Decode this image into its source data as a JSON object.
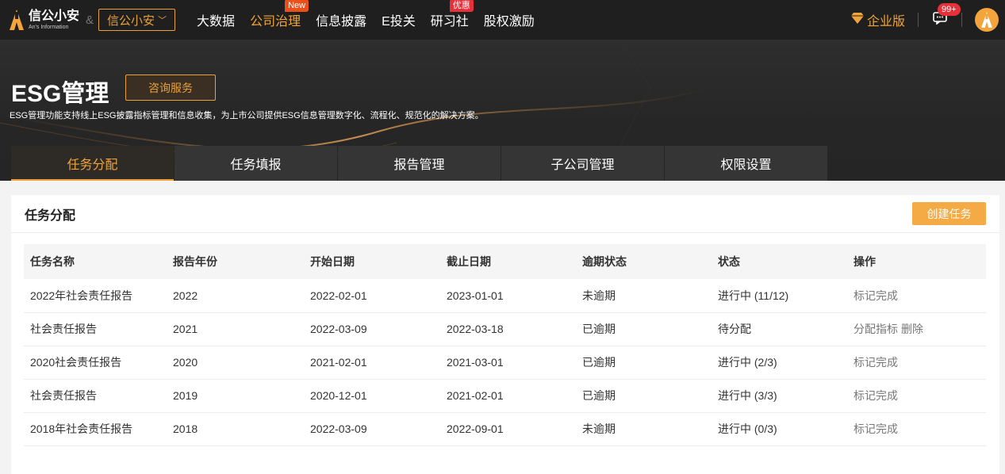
{
  "topnav": {
    "logo_name": "信公小安",
    "logo_sub": "An's Information",
    "amp": "&",
    "brand_select": "信公小安",
    "links": [
      {
        "label": "大数据",
        "badge": ""
      },
      {
        "label": "公司治理",
        "badge": "New"
      },
      {
        "label": "信息披露",
        "badge": ""
      },
      {
        "label": "E投关",
        "badge": ""
      },
      {
        "label": "研习社",
        "badge": "优惠"
      },
      {
        "label": "股权激励",
        "badge": ""
      }
    ],
    "enterprise": "企业版",
    "msg_badge": "99+"
  },
  "banner": {
    "title": "ESG管理",
    "consult_button": "咨询服务",
    "description": "ESG管理功能支持线上ESG披露指标管理和信息收集，为上市公司提供ESG信息管理数字化、流程化、规范化的解决方案。",
    "tabs": [
      "任务分配",
      "任务填报",
      "报告管理",
      "子公司管理",
      "权限设置"
    ],
    "active_tab": 0
  },
  "card": {
    "title": "任务分配",
    "create_button": "创建任务"
  },
  "table": {
    "headers": [
      "任务名称",
      "报告年份",
      "开始日期",
      "截止日期",
      "逾期状态",
      "状态",
      "操作"
    ],
    "rows": [
      {
        "name": "2022年社会责任报告",
        "year": "2022",
        "start": "2022-02-01",
        "end": "2023-01-01",
        "overdue": "未逾期",
        "status": "进行中 (11/12)",
        "ops": [
          "标记完成"
        ]
      },
      {
        "name": "社会责任报告",
        "year": "2021",
        "start": "2022-03-09",
        "end": "2022-03-18",
        "overdue": "已逾期",
        "status": "待分配",
        "ops": [
          "分配指标",
          "删除"
        ]
      },
      {
        "name": "2020社会责任报告",
        "year": "2020",
        "start": "2021-02-01",
        "end": "2021-03-01",
        "overdue": "已逾期",
        "status": "进行中 (2/3)",
        "ops": [
          "标记完成"
        ]
      },
      {
        "name": "社会责任报告",
        "year": "2019",
        "start": "2020-12-01",
        "end": "2021-02-01",
        "overdue": "已逾期",
        "status": "进行中 (3/3)",
        "ops": [
          "标记完成"
        ]
      },
      {
        "name": "2018年社会责任报告",
        "year": "2018",
        "start": "2022-03-09",
        "end": "2022-09-01",
        "overdue": "未逾期",
        "status": "进行中 (0/3)",
        "ops": [
          "标记完成"
        ]
      }
    ]
  },
  "colors": {
    "accent": "#f0a33a",
    "topnav_bg": "#1f1f1f",
    "banner_bg": "#2e2e2e",
    "create_button_bg": "#f5ab45"
  }
}
